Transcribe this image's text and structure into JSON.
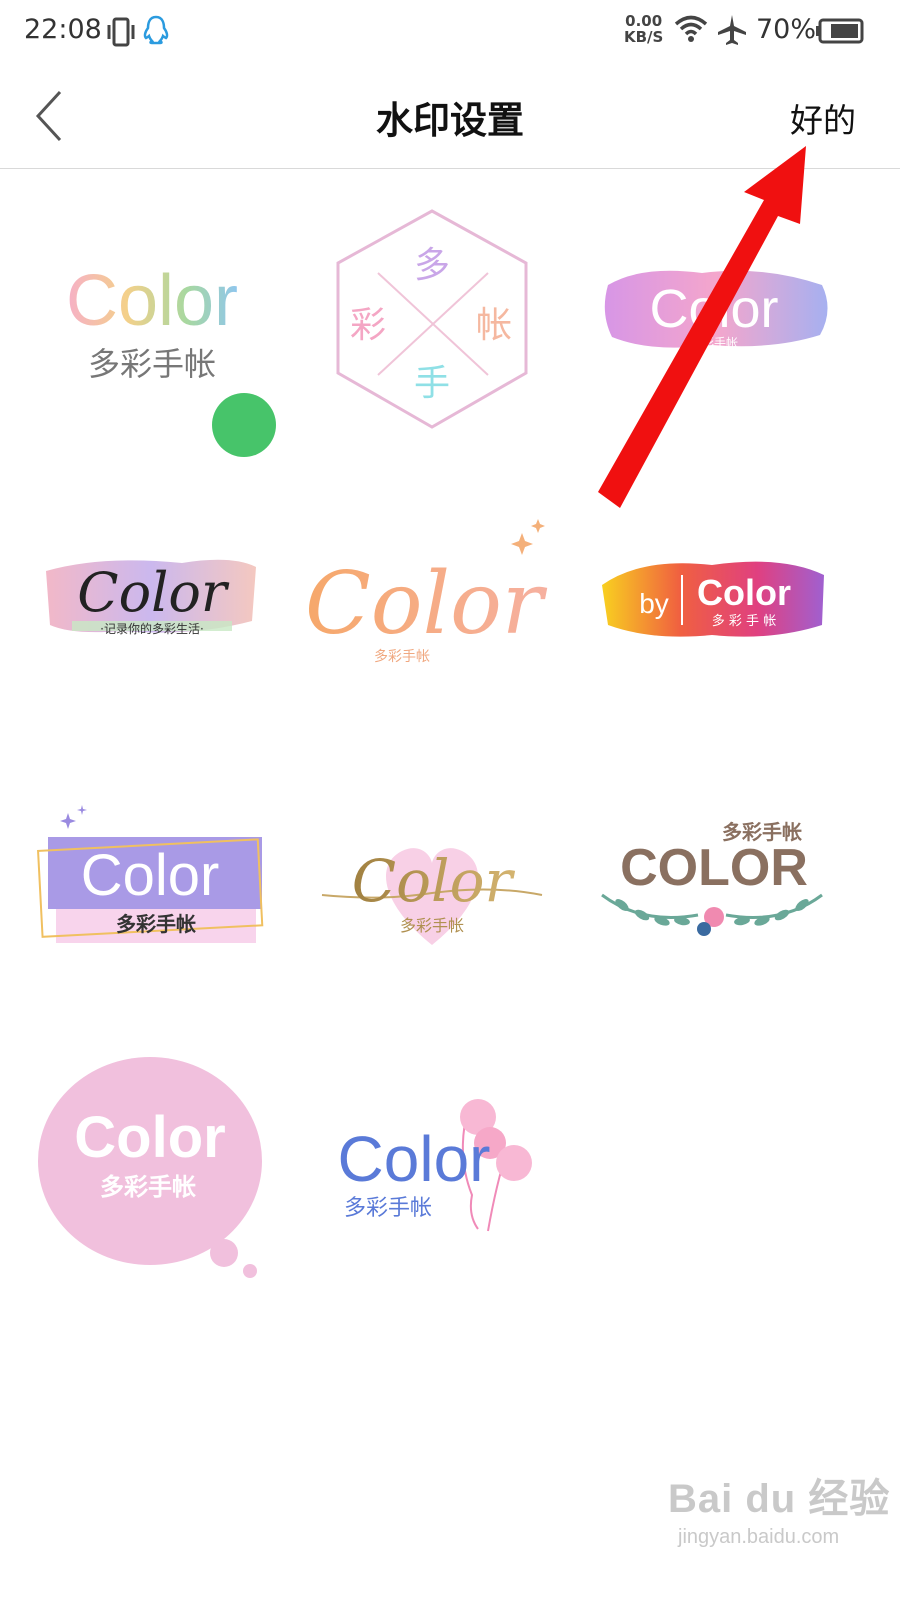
{
  "status_bar": {
    "time": "22:08",
    "net_speed": "0.00",
    "net_unit": "KB/S",
    "battery_percent": "70%",
    "icons": [
      "vibrate-icon",
      "qq-icon",
      "wifi-icon",
      "airplane-icon",
      "battery-icon"
    ]
  },
  "nav": {
    "title": "水印设置",
    "confirm_label": "好的",
    "back_icon": "chevron-left-icon"
  },
  "watermarks": [
    {
      "id": "wm1",
      "brand": "Color",
      "sub": "多彩手帐",
      "selected": true
    },
    {
      "id": "wm2",
      "chars": [
        "多",
        "彩",
        "帐",
        "手"
      ]
    },
    {
      "id": "wm3",
      "brand": "Color",
      "sub": "多彩手帐"
    },
    {
      "id": "wm4",
      "brand": "Color",
      "sub": "·记录你的多彩生活·"
    },
    {
      "id": "wm5",
      "brand": "Color",
      "sub": "多彩手帐"
    },
    {
      "id": "wm6",
      "prefix": "by",
      "brand": "Color",
      "sub": "多 彩 手 帐"
    },
    {
      "id": "wm7",
      "brand": "Color",
      "sub": "多彩手帐"
    },
    {
      "id": "wm8",
      "brand": "Color",
      "sub": "多彩手帐"
    },
    {
      "id": "wm9",
      "brand": "COLOR",
      "sub": "多彩手帐"
    },
    {
      "id": "wm10",
      "brand": "Color",
      "sub": "多彩手帐"
    },
    {
      "id": "wm11",
      "brand": "Color",
      "sub": "多彩手帐"
    }
  ],
  "selected_check_icon": "checkmark-icon",
  "annotation_arrow": "red-arrow-pointing-to-confirm",
  "watermark_footer": {
    "logo": "Bai du 经验",
    "url": "jingyan.baidu.com"
  },
  "colors": {
    "check_green": "#47c46a",
    "arrow_red": "#f01010",
    "divider": "#d9d9d9"
  }
}
